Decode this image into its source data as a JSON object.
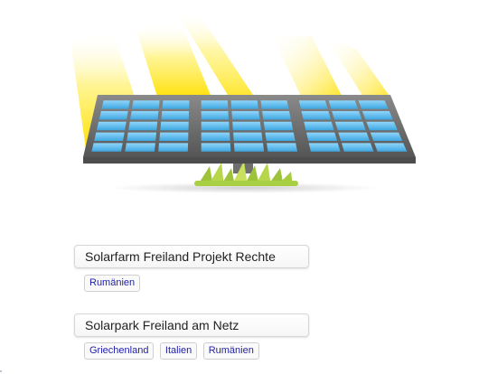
{
  "hero": {
    "image_name": "solar-panel-illustration"
  },
  "projects": [
    {
      "title": "Solarfarm Freiland Projekt Rechte",
      "countries": [
        "Rumänien"
      ]
    },
    {
      "title": "Solarpark Freiland am Netz",
      "countries": [
        "Griechenland",
        "Italien",
        "Rumänien"
      ]
    }
  ],
  "colors": {
    "tag_text": "#1f1fa8",
    "sun_ray": "#ffe000",
    "cell": "#4ab3ea",
    "frame": "#6b6b6b"
  }
}
